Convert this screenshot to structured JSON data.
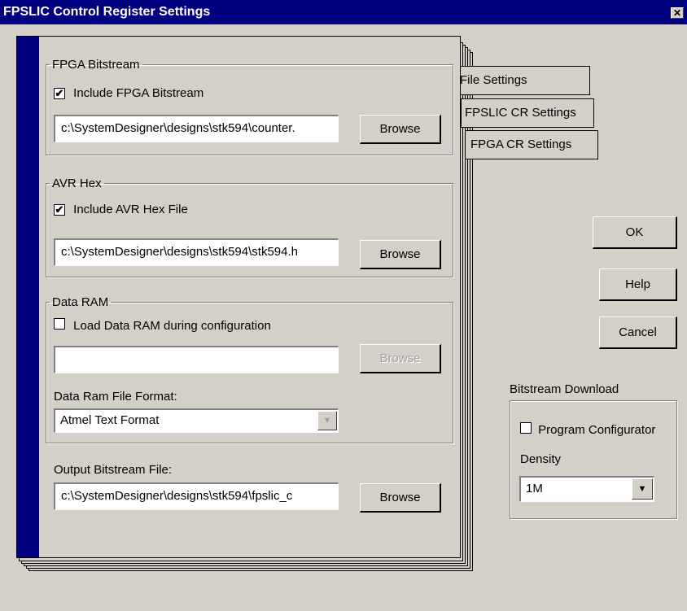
{
  "window": {
    "title": "FPSLIC Control Register Settings",
    "close_glyph": "✕"
  },
  "tabs": [
    "File Settings",
    "FPSLIC CR Settings",
    "FPGA CR Settings"
  ],
  "fpga_bitstream": {
    "legend": "FPGA Bitstream",
    "include_label": "Include FPGA Bitstream",
    "include_checked": true,
    "path": "c:\\SystemDesigner\\designs\\stk594\\counter.",
    "browse_label": "Browse"
  },
  "avr_hex": {
    "legend": "AVR Hex",
    "include_label": "Include AVR Hex File",
    "include_checked": true,
    "path": "c:\\SystemDesigner\\designs\\stk594\\stk594.h",
    "browse_label": "Browse"
  },
  "data_ram": {
    "legend": "Data RAM",
    "load_label": "Load Data RAM during configuration",
    "load_checked": false,
    "path": "",
    "browse_label": "Browse",
    "format_label": "Data Ram File Format:",
    "format_value": "Atmel Text Format"
  },
  "output": {
    "label": "Output Bitstream File:",
    "path": "c:\\SystemDesigner\\designs\\stk594\\fpslic_c",
    "browse_label": "Browse"
  },
  "buttons": {
    "ok": "OK",
    "help": "Help",
    "cancel": "Cancel"
  },
  "bitstream_download": {
    "title": "Bitstream Download",
    "program_label": "Program Configurator",
    "program_checked": false,
    "density_label": "Density",
    "density_value": "1M"
  },
  "icons": {
    "check": "✔",
    "dropdown": "▼"
  }
}
